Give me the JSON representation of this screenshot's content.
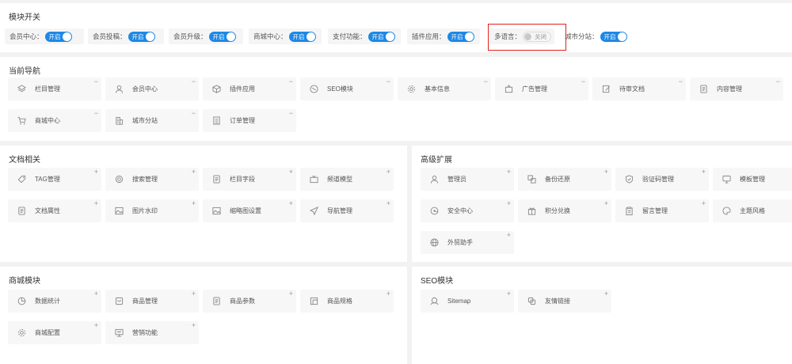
{
  "module_switch": {
    "title": "模块开关",
    "items": [
      {
        "label": "会员中心：",
        "state": "开启",
        "on": true
      },
      {
        "label": "会员投稿：",
        "state": "开启",
        "on": true
      },
      {
        "label": "会员升级：",
        "state": "开启",
        "on": true
      },
      {
        "label": "商城中心：",
        "state": "开启",
        "on": true
      },
      {
        "label": "支付功能：",
        "state": "开启",
        "on": true
      },
      {
        "label": "插件应用：",
        "state": "开启",
        "on": true
      },
      {
        "label": "多语言：",
        "state": "关闭",
        "on": false
      },
      {
        "label": "城市分站：",
        "state": "开启",
        "on": true
      }
    ]
  },
  "current_nav": {
    "title": "当前导航",
    "items": [
      {
        "label": "栏目管理",
        "icon": "layers-icon",
        "btn": "−"
      },
      {
        "label": "会员中心",
        "icon": "user-icon",
        "btn": "−"
      },
      {
        "label": "插件应用",
        "icon": "cube-icon",
        "btn": "−"
      },
      {
        "label": "SEO模块",
        "icon": "seo-icon",
        "btn": "−"
      },
      {
        "label": "基本信息",
        "icon": "gear-icon",
        "btn": "−"
      },
      {
        "label": "广告管理",
        "icon": "ad-icon",
        "btn": "−"
      },
      {
        "label": "待审文档",
        "icon": "edit-icon",
        "btn": "−"
      },
      {
        "label": "内容管理",
        "icon": "doc-icon",
        "btn": "−"
      },
      {
        "label": "商城中心",
        "icon": "cart-icon",
        "btn": "−"
      },
      {
        "label": "城市分站",
        "icon": "building-icon",
        "btn": "−"
      },
      {
        "label": "订单管理",
        "icon": "list-icon",
        "btn": "−"
      }
    ]
  },
  "doc_related": {
    "title": "文档相关",
    "items": [
      {
        "label": "TAG管理",
        "icon": "tag-icon",
        "btn": "+"
      },
      {
        "label": "搜索管理",
        "icon": "search-icon",
        "btn": "+"
      },
      {
        "label": "栏目字段",
        "icon": "doc-icon",
        "btn": "+"
      },
      {
        "label": "频道模型",
        "icon": "tv-icon",
        "btn": "+"
      },
      {
        "label": "文档属性",
        "icon": "doc-icon",
        "btn": "+"
      },
      {
        "label": "图片水印",
        "icon": "image-icon",
        "btn": "+"
      },
      {
        "label": "缩略图设置",
        "icon": "image-icon",
        "btn": "+"
      },
      {
        "label": "导航管理",
        "icon": "send-icon",
        "btn": "+"
      }
    ]
  },
  "advanced": {
    "title": "高级扩展",
    "items": [
      {
        "label": "管理员",
        "icon": "user-icon",
        "btn": "+"
      },
      {
        "label": "备份还原",
        "icon": "backup-icon",
        "btn": "+"
      },
      {
        "label": "验证码管理",
        "icon": "shield-icon",
        "btn": "+"
      },
      {
        "label": "模板管理",
        "icon": "monitor-icon",
        "btn": "+"
      },
      {
        "label": "安全中心",
        "icon": "safe-icon",
        "btn": "+"
      },
      {
        "label": "积分兑换",
        "icon": "gift-icon",
        "btn": "+"
      },
      {
        "label": "留言管理",
        "icon": "clipboard-icon",
        "btn": "+"
      },
      {
        "label": "主题风格",
        "icon": "palette-icon",
        "btn": "+"
      },
      {
        "label": "外贸助手",
        "icon": "globe-icon",
        "btn": "+"
      }
    ]
  },
  "shop": {
    "title": "商城模块",
    "items": [
      {
        "label": "数据统计",
        "icon": "pie-icon",
        "btn": "+"
      },
      {
        "label": "商品管理",
        "icon": "box-icon",
        "btn": "+"
      },
      {
        "label": "商品参数",
        "icon": "doc-icon",
        "btn": "+"
      },
      {
        "label": "商品规格",
        "icon": "spec-icon",
        "btn": "+"
      },
      {
        "label": "商城配置",
        "icon": "gear-icon",
        "btn": "+"
      },
      {
        "label": "营销功能",
        "icon": "screen-icon",
        "btn": "+"
      }
    ]
  },
  "seo": {
    "title": "SEO模块",
    "items": [
      {
        "label": "Sitemap",
        "icon": "sitemap-icon",
        "btn": "+"
      },
      {
        "label": "友情链接",
        "icon": "link-icon",
        "btn": "+"
      }
    ]
  },
  "colors": {
    "accent": "#1e88e5",
    "highlight": "#e0201b"
  }
}
